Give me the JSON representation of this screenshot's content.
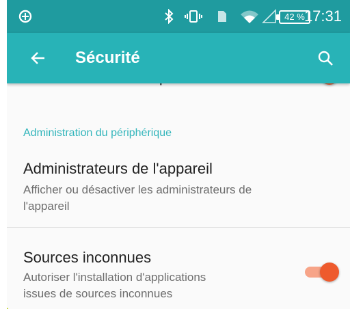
{
  "status_bar": {
    "icons": [
      "data-saver-icon",
      "bluetooth-icon",
      "vibrate-icon",
      "sim-card-icon",
      "wifi-icon",
      "signal-icon"
    ],
    "battery": "42 %",
    "time": "17:31"
  },
  "app_bar": {
    "title": "Sécurité"
  },
  "settings": {
    "partial_item": {
      "label": "Afficher les mots de passe",
      "toggle_on": true
    },
    "section_header": "Administration du périphérique",
    "items": [
      {
        "title": "Administrateurs de l'appareil",
        "subtitle_line1": "Afficher ou désactiver les administrateurs de",
        "subtitle_line2": "l'appareil"
      },
      {
        "title": "Sources inconnues",
        "subtitle_line1": "Autoriser l'installation d'applications",
        "subtitle_line2": "issues de sources inconnues",
        "toggle_on": true
      }
    ]
  },
  "colors": {
    "status_bar": "#1f9b9f",
    "app_bar": "#28b3b7",
    "accent": "#32b5bb",
    "toggle_thumb": "#ee5a2d",
    "toggle_track": "#f7a488"
  }
}
